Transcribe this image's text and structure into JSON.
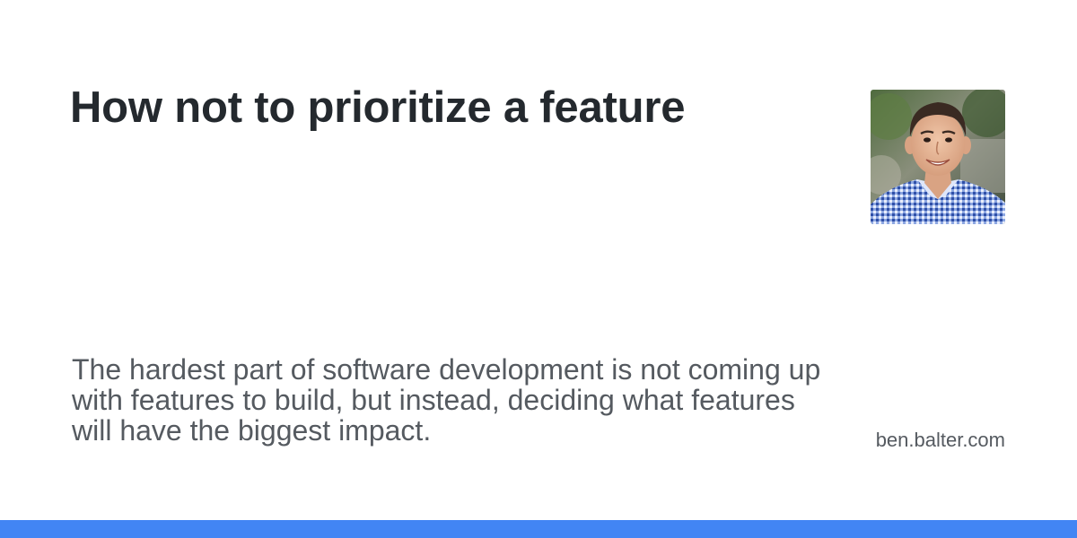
{
  "card": {
    "title": "How not to prioritize a feature",
    "description": "The hardest part of software development is not coming up with features to build, but instead, deciding what features will have the biggest impact.",
    "site": "ben.balter.com"
  },
  "avatar": {
    "subject": "author-headshot"
  },
  "colors": {
    "title": "#24292e",
    "text": "#555a60",
    "accent": "#4285f4",
    "background": "#ffffff"
  }
}
